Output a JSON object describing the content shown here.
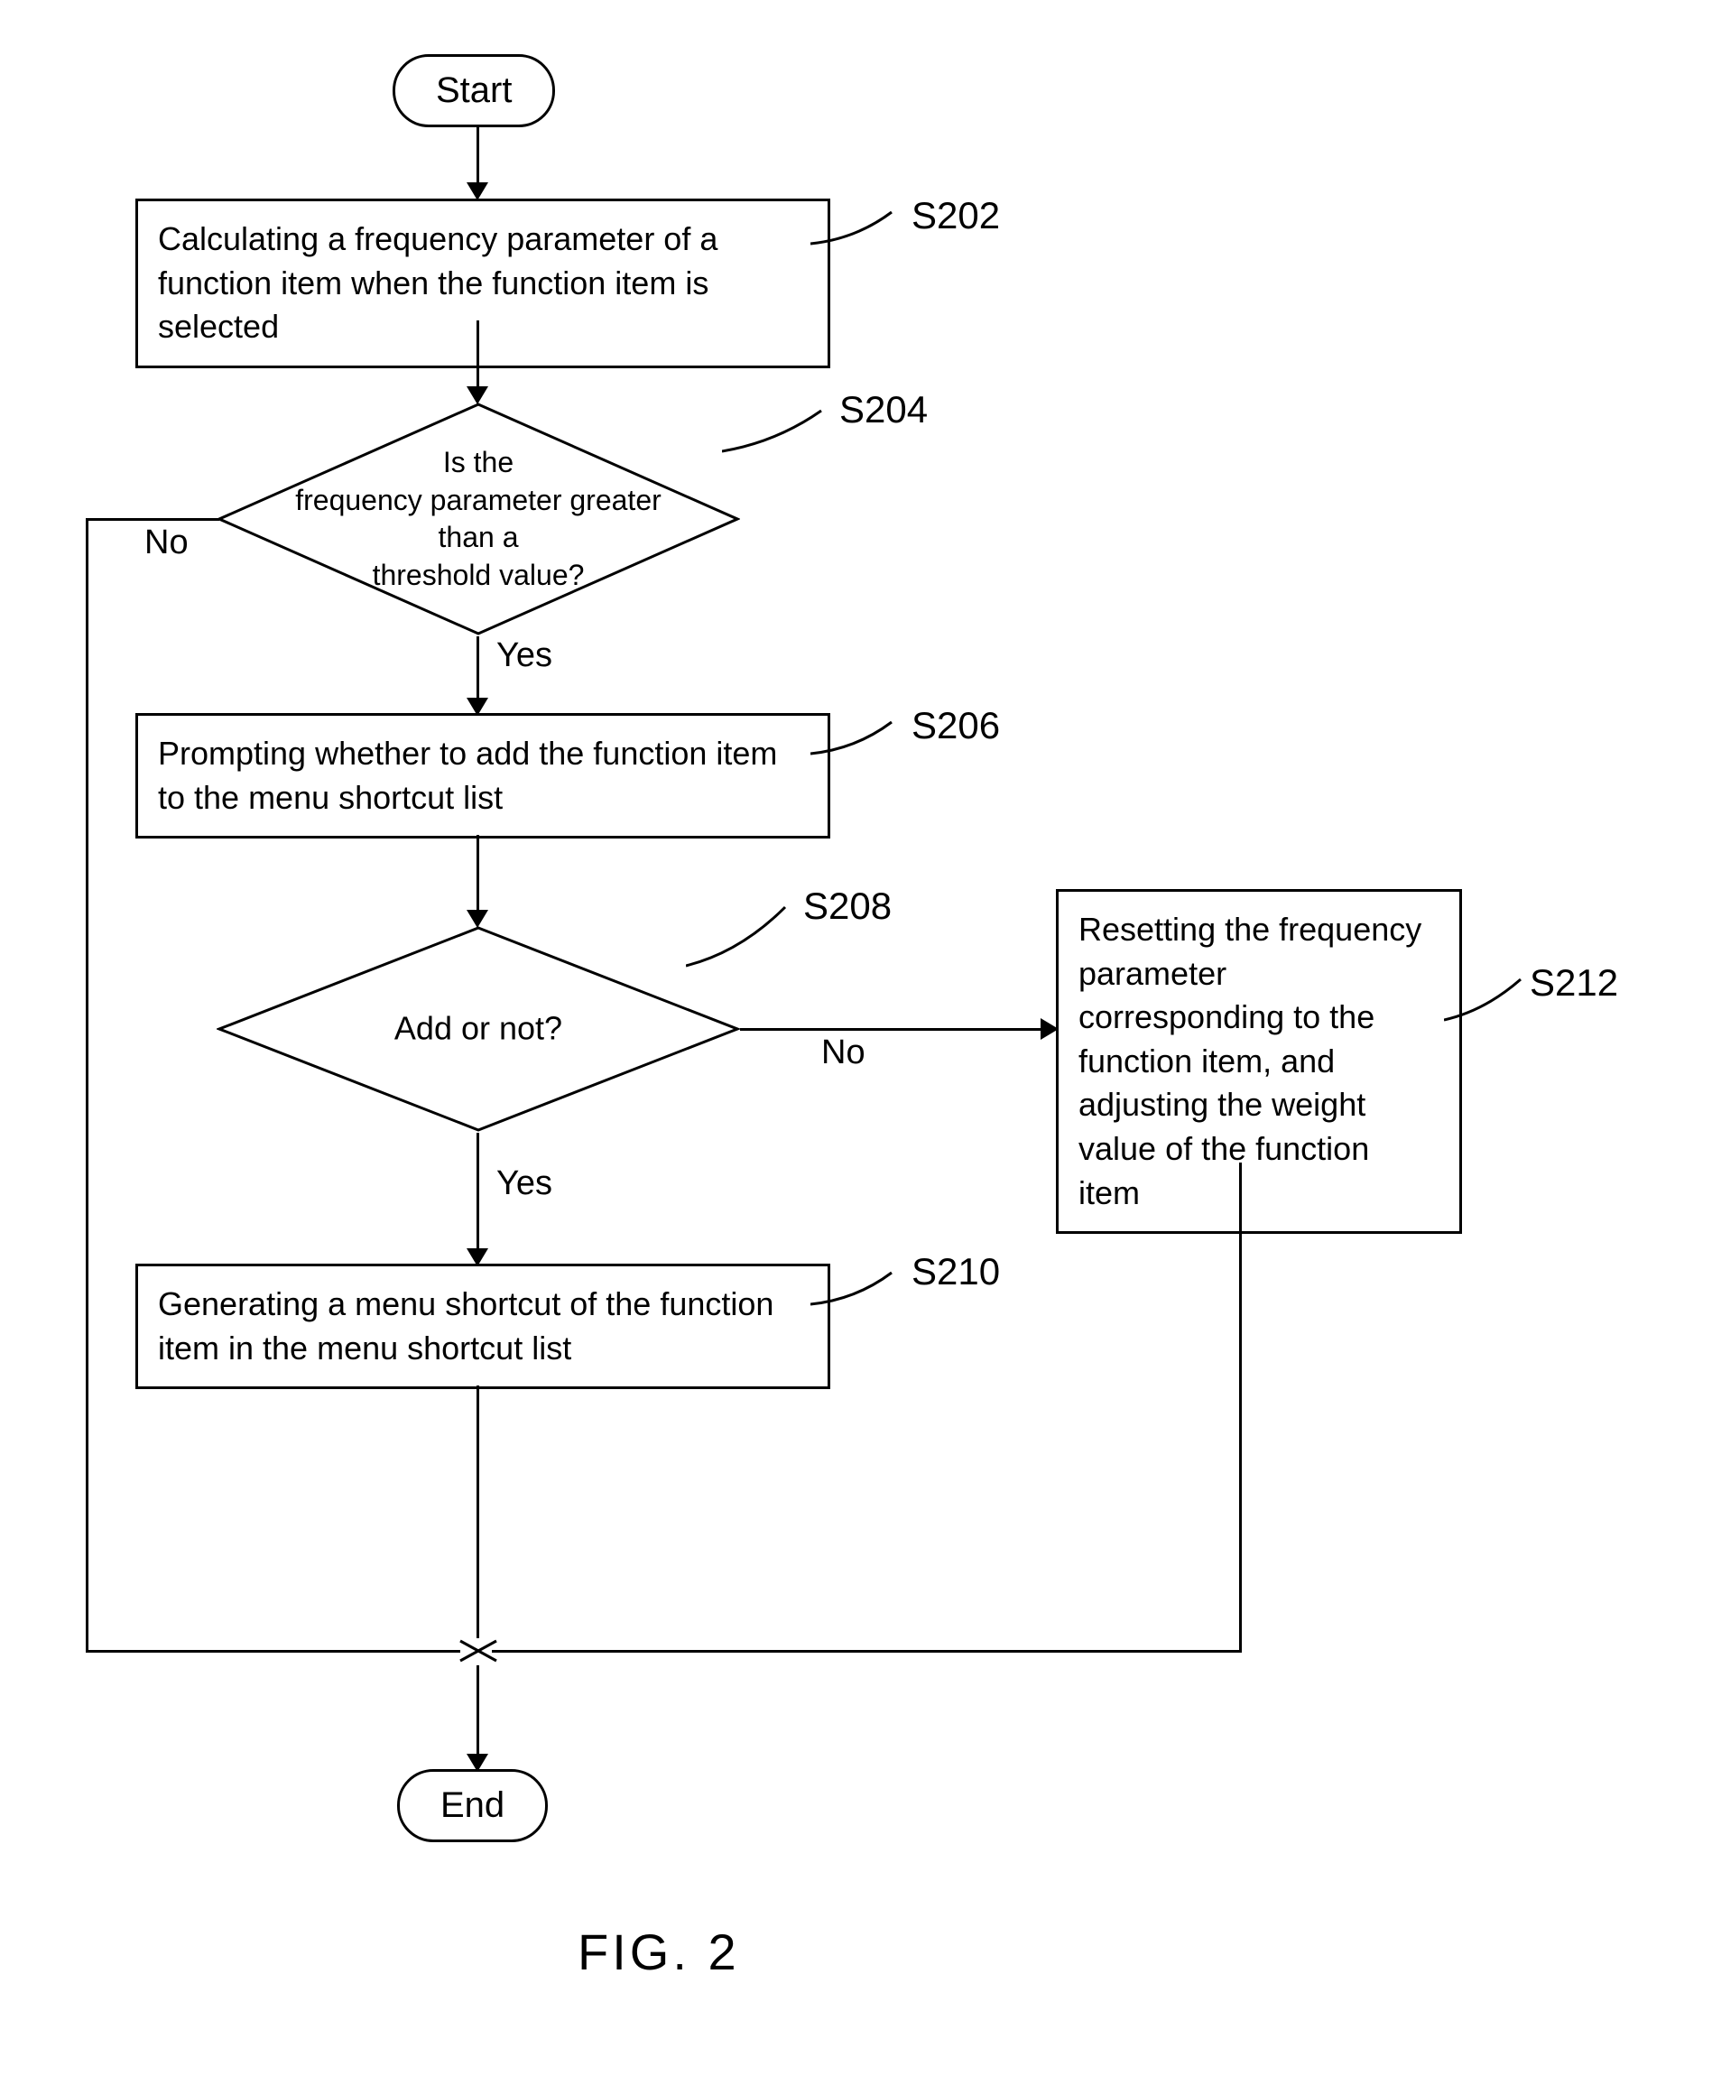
{
  "chart_data": {
    "type": "flowchart",
    "title": "FIG. 2",
    "nodes": [
      {
        "id": "start",
        "type": "terminal",
        "text": "Start"
      },
      {
        "id": "S202",
        "type": "process",
        "label": "S202",
        "text": "Calculating a frequency parameter of a function item when the function item is selected"
      },
      {
        "id": "S204",
        "type": "decision",
        "label": "S204",
        "text": "Is the frequency parameter greater than a threshold value?"
      },
      {
        "id": "S206",
        "type": "process",
        "label": "S206",
        "text": "Prompting whether to add the function item to the menu shortcut list"
      },
      {
        "id": "S208",
        "type": "decision",
        "label": "S208",
        "text": "Add or not?"
      },
      {
        "id": "S210",
        "type": "process",
        "label": "S210",
        "text": "Generating a menu shortcut of the function item in the menu shortcut list"
      },
      {
        "id": "S212",
        "type": "process",
        "label": "S212",
        "text": "Resetting the frequency parameter corresponding to the function item, and adjusting the weight value of the function item"
      },
      {
        "id": "end",
        "type": "terminal",
        "text": "End"
      }
    ],
    "edges": [
      {
        "from": "start",
        "to": "S202"
      },
      {
        "from": "S202",
        "to": "S204"
      },
      {
        "from": "S204",
        "to": "S206",
        "label": "Yes"
      },
      {
        "from": "S204",
        "to": "end",
        "label": "No"
      },
      {
        "from": "S206",
        "to": "S208"
      },
      {
        "from": "S208",
        "to": "S210",
        "label": "Yes"
      },
      {
        "from": "S208",
        "to": "S212",
        "label": "No"
      },
      {
        "from": "S210",
        "to": "end"
      },
      {
        "from": "S212",
        "to": "end"
      }
    ]
  },
  "terminals": {
    "start": "Start",
    "end": "End"
  },
  "processes": {
    "s202": "Calculating a frequency parameter of a function item when the function item is selected",
    "s206": "Prompting whether to add the function item to the menu shortcut list",
    "s210": "Generating a menu shortcut of the function item in the menu shortcut list",
    "s212": "Resetting the frequency parameter corresponding to the function item, and adjusting the weight value of the function item"
  },
  "decisions": {
    "s204_l1": "Is the",
    "s204_l2": "frequency parameter greater than a",
    "s204_l3": "threshold value?",
    "s208": "Add or not?"
  },
  "labels": {
    "s202": "S202",
    "s204": "S204",
    "s206": "S206",
    "s208": "S208",
    "s210": "S210",
    "s212": "S212"
  },
  "edge_labels": {
    "yes": "Yes",
    "no": "No"
  },
  "figure": "FIG. 2"
}
